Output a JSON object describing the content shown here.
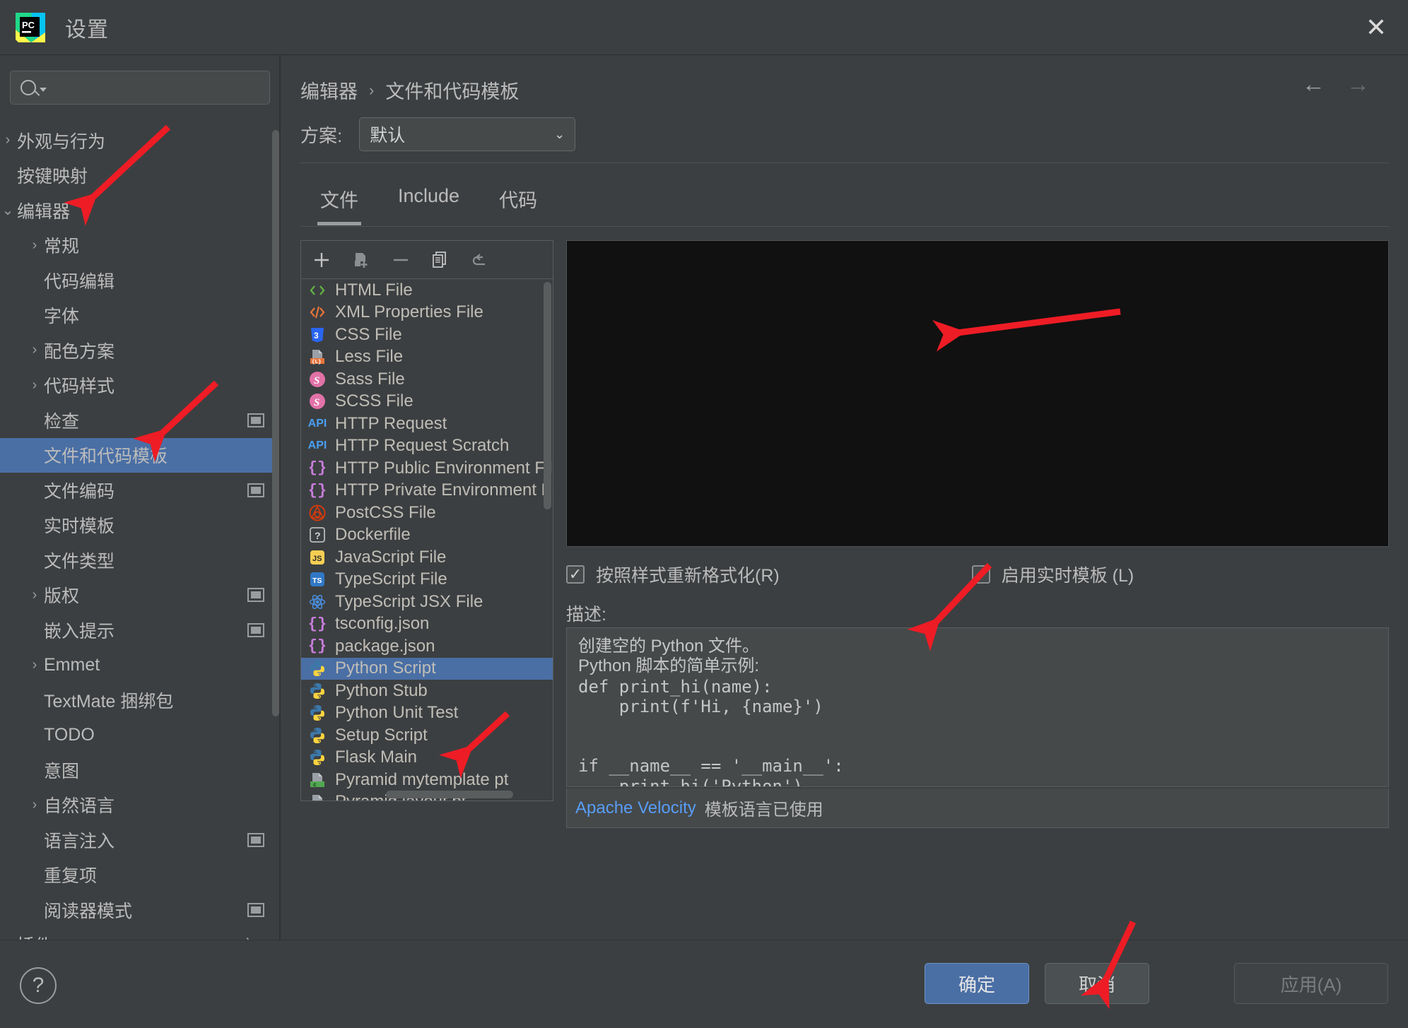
{
  "window": {
    "title": "设置",
    "logo_text": "PC",
    "close_icon": "✕"
  },
  "sidebar": {
    "search_placeholder": "",
    "items": [
      {
        "label": "外观与行为",
        "twisty": "›",
        "indent": 0,
        "selected": false,
        "badge": false
      },
      {
        "label": "按键映射",
        "twisty": "",
        "indent": 0,
        "selected": false,
        "badge": false
      },
      {
        "label": "编辑器",
        "twisty": "⌄",
        "indent": 0,
        "selected": false,
        "badge": false
      },
      {
        "label": "常规",
        "twisty": "›",
        "indent": 1,
        "selected": false,
        "badge": false
      },
      {
        "label": "代码编辑",
        "twisty": "",
        "indent": 1,
        "selected": false,
        "badge": false
      },
      {
        "label": "字体",
        "twisty": "",
        "indent": 1,
        "selected": false,
        "badge": false
      },
      {
        "label": "配色方案",
        "twisty": "›",
        "indent": 1,
        "selected": false,
        "badge": false
      },
      {
        "label": "代码样式",
        "twisty": "›",
        "indent": 1,
        "selected": false,
        "badge": false
      },
      {
        "label": "检查",
        "twisty": "",
        "indent": 1,
        "selected": false,
        "badge": true
      },
      {
        "label": "文件和代码模板",
        "twisty": "",
        "indent": 1,
        "selected": true,
        "badge": false
      },
      {
        "label": "文件编码",
        "twisty": "",
        "indent": 1,
        "selected": false,
        "badge": true
      },
      {
        "label": "实时模板",
        "twisty": "",
        "indent": 1,
        "selected": false,
        "badge": false
      },
      {
        "label": "文件类型",
        "twisty": "",
        "indent": 1,
        "selected": false,
        "badge": false
      },
      {
        "label": "版权",
        "twisty": "›",
        "indent": 1,
        "selected": false,
        "badge": true
      },
      {
        "label": "嵌入提示",
        "twisty": "",
        "indent": 1,
        "selected": false,
        "badge": true
      },
      {
        "label": "Emmet",
        "twisty": "›",
        "indent": 1,
        "selected": false,
        "badge": false
      },
      {
        "label": "TextMate 捆绑包",
        "twisty": "",
        "indent": 1,
        "selected": false,
        "badge": false
      },
      {
        "label": "TODO",
        "twisty": "",
        "indent": 1,
        "selected": false,
        "badge": false
      },
      {
        "label": "意图",
        "twisty": "",
        "indent": 1,
        "selected": false,
        "badge": false
      },
      {
        "label": "自然语言",
        "twisty": "›",
        "indent": 1,
        "selected": false,
        "badge": false
      },
      {
        "label": "语言注入",
        "twisty": "",
        "indent": 1,
        "selected": false,
        "badge": true
      },
      {
        "label": "重复项",
        "twisty": "",
        "indent": 1,
        "selected": false,
        "badge": false
      },
      {
        "label": "阅读器模式",
        "twisty": "",
        "indent": 1,
        "selected": false,
        "badge": true
      },
      {
        "label": "插件",
        "twisty": "",
        "indent": 0,
        "selected": false,
        "badge": false,
        "trailing_icon": "文A"
      }
    ]
  },
  "main": {
    "breadcrumb": {
      "parent": "编辑器",
      "separator": "›",
      "current": "文件和代码模板"
    },
    "nav": {
      "back": "←",
      "forward": "→"
    },
    "scheme": {
      "label": "方案:",
      "value": "默认",
      "chevron": "⌄"
    },
    "tabs": [
      {
        "label": "文件",
        "active": true
      },
      {
        "label": "Include",
        "active": false
      },
      {
        "label": "代码",
        "active": false
      }
    ],
    "toolbar": {
      "add": "add-icon",
      "copy_template": "copy-template-icon",
      "remove": "remove-icon",
      "duplicate": "duplicate-icon",
      "reset": "reset-icon"
    },
    "templates": [
      {
        "name": "HTML File",
        "icon": "html",
        "selected": false
      },
      {
        "name": "XML Properties File",
        "icon": "xml",
        "selected": false
      },
      {
        "name": "CSS File",
        "icon": "css",
        "selected": false
      },
      {
        "name": "Less File",
        "icon": "less",
        "selected": false
      },
      {
        "name": "Sass File",
        "icon": "sass",
        "selected": false
      },
      {
        "name": "SCSS File",
        "icon": "scss",
        "selected": false
      },
      {
        "name": "HTTP Request",
        "icon": "api",
        "selected": false
      },
      {
        "name": "HTTP Request Scratch",
        "icon": "api",
        "selected": false
      },
      {
        "name": "HTTP Public Environment File",
        "icon": "braces",
        "selected": false
      },
      {
        "name": "HTTP Private Environment File",
        "icon": "braces",
        "selected": false
      },
      {
        "name": "PostCSS File",
        "icon": "postcss",
        "selected": false
      },
      {
        "name": "Dockerfile",
        "icon": "question",
        "selected": false
      },
      {
        "name": "JavaScript File",
        "icon": "js",
        "selected": false
      },
      {
        "name": "TypeScript File",
        "icon": "ts",
        "selected": false
      },
      {
        "name": "TypeScript JSX File",
        "icon": "react",
        "selected": false
      },
      {
        "name": "tsconfig.json",
        "icon": "braces",
        "selected": false
      },
      {
        "name": "package.json",
        "icon": "braces",
        "selected": false
      },
      {
        "name": "Python Script",
        "icon": "python",
        "selected": true
      },
      {
        "name": "Python Stub",
        "icon": "python",
        "selected": false
      },
      {
        "name": "Python Unit Test",
        "icon": "python",
        "selected": false
      },
      {
        "name": "Setup Script",
        "icon": "python",
        "selected": false
      },
      {
        "name": "Flask Main",
        "icon": "python",
        "selected": false
      },
      {
        "name": "Pyramid mytemplate pt",
        "icon": "chameleon",
        "selected": false
      },
      {
        "name": "Pyramid layout pt",
        "icon": "chameleon",
        "selected": false
      }
    ],
    "options": {
      "reformat_label": "按照样式重新格式化(R)",
      "reformat_checked": true,
      "live_template_label": "启用实时模板 (L)",
      "live_template_checked": false
    },
    "description": {
      "label": "描述:",
      "lines": [
        "创建空的 Python 文件。",
        "Python 脚本的简单示例:",
        "def print_hi(name):",
        "    print(f'Hi, {name}')",
        "",
        "",
        "if __name__ == '__main__':",
        "    print_hi('Python')"
      ]
    },
    "velocity": {
      "link": "Apache Velocity",
      "text": "模板语言已使用"
    }
  },
  "bottom": {
    "help": "?",
    "ok": "确定",
    "cancel": "取消",
    "apply": "应用(A)"
  },
  "colors": {
    "accent": "#4a6fa5",
    "background": "#3c3f41",
    "panel": "#45494a",
    "text": "#bbbbbb",
    "link": "#589df6",
    "annotation": "#ee1c25"
  }
}
